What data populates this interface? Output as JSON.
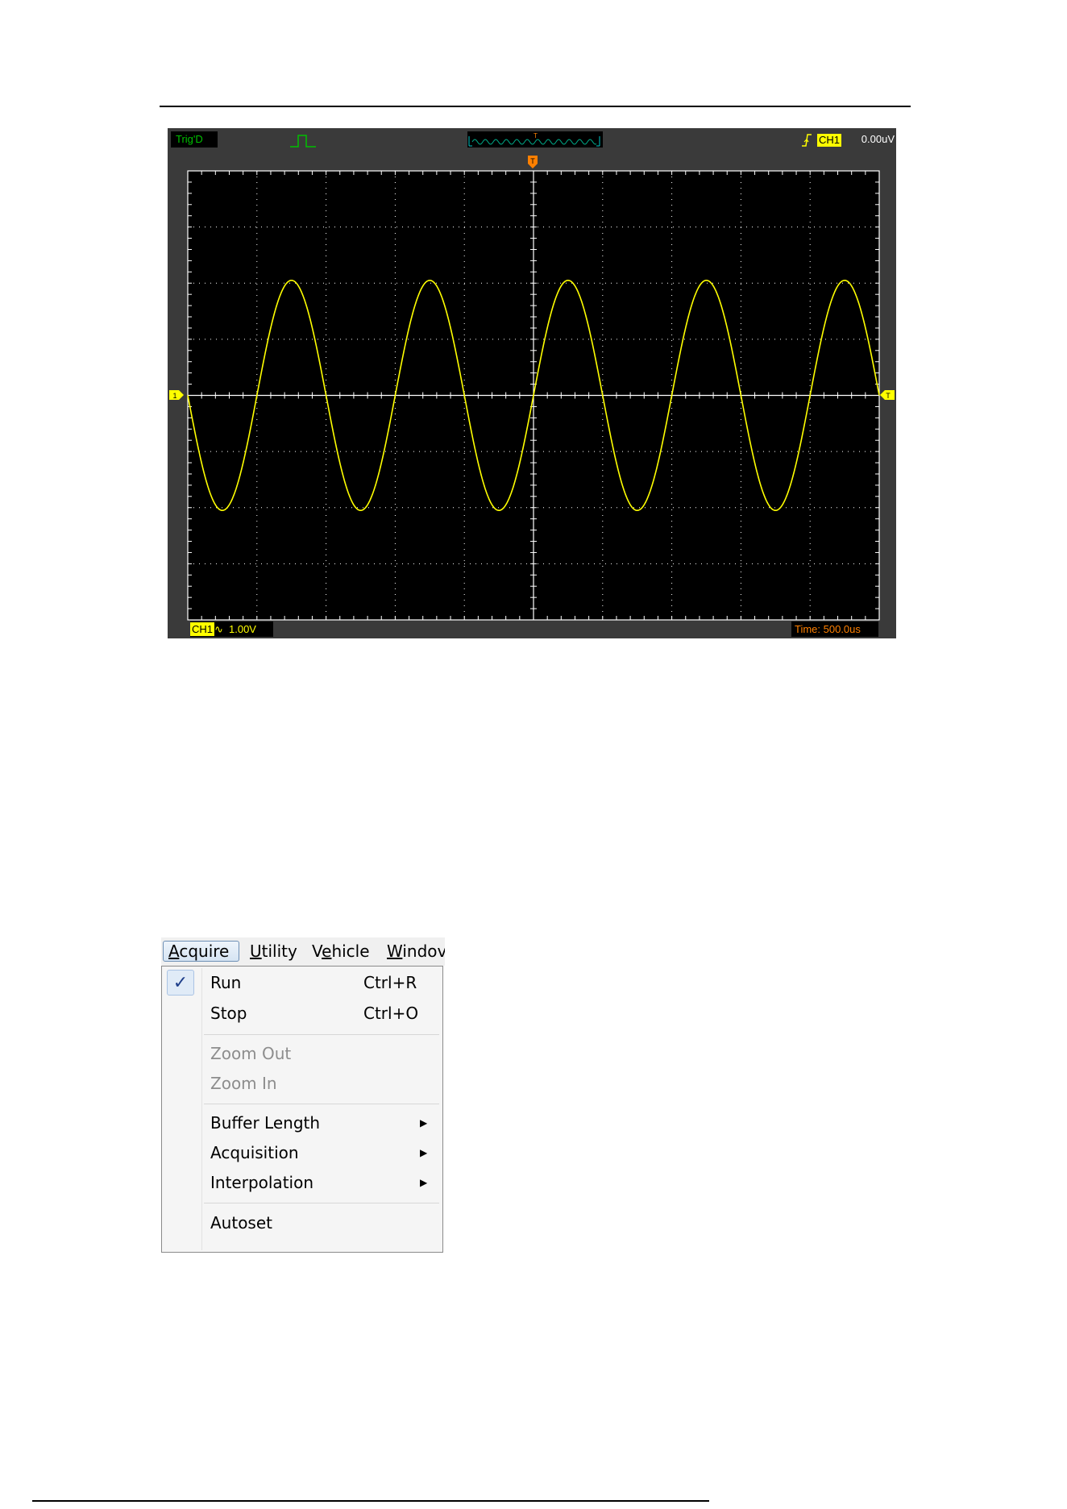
{
  "scope": {
    "trigger_status": "Trig'D",
    "trigger_channel": "CH1",
    "trigger_level": "0.00uV",
    "trigger_marker": "T",
    "channel_marker": "1",
    "channel_label": "CH1",
    "coupling_symbol": "∿",
    "volts_per_div": "1.00V",
    "timebase": "Time: 500.0us",
    "colors": {
      "trace": "#ffff00",
      "status_green": "#00c000",
      "trigger_orange": "#ff8000",
      "grid": "#ffffff",
      "screen": "#000000"
    },
    "icons": [
      "pulse-icon",
      "rising-edge-trigger-icon"
    ],
    "waveform": {
      "type": "sine",
      "grid_divisions": {
        "x": 10,
        "y": 8
      },
      "amplitude_divs": 2.05,
      "cycles_on_screen": 5,
      "offset_divs": 0
    }
  },
  "menu": {
    "menubar": [
      {
        "label": "Acquire",
        "mnemonic": "A",
        "rest": "cquire"
      },
      {
        "label": "Utility",
        "mnemonic": "U",
        "rest": "tility"
      },
      {
        "label": "Vehicle",
        "pre": "V",
        "mnemonic": "e",
        "rest": "hicle"
      },
      {
        "label": "Window",
        "mnemonic": "W",
        "rest": "indov"
      }
    ],
    "items": [
      {
        "label": "Run",
        "shortcut": "Ctrl+R",
        "checked": true,
        "disabled": false
      },
      {
        "label": "Stop",
        "shortcut": "Ctrl+O",
        "checked": false,
        "disabled": false
      },
      {
        "label": "Zoom Out",
        "disabled": true
      },
      {
        "label": "Zoom In",
        "disabled": true
      },
      {
        "label": "Buffer Length",
        "submenu": true
      },
      {
        "label": "Acquisition",
        "submenu": true
      },
      {
        "label": "Interpolation",
        "submenu": true
      },
      {
        "label": "Autoset"
      }
    ],
    "checkmark": "✓",
    "submenu_arrow": "▶"
  }
}
